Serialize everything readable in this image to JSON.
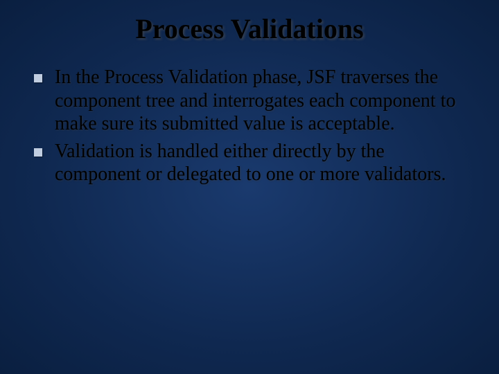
{
  "slide": {
    "title": "Process Validations",
    "bullets": [
      "In the Process Validation phase, JSF traverses the component tree and interrogates each component to make sure its submitted value is acceptable.",
      "Validation is handled either directly by the component or delegated to one or more validators."
    ]
  }
}
